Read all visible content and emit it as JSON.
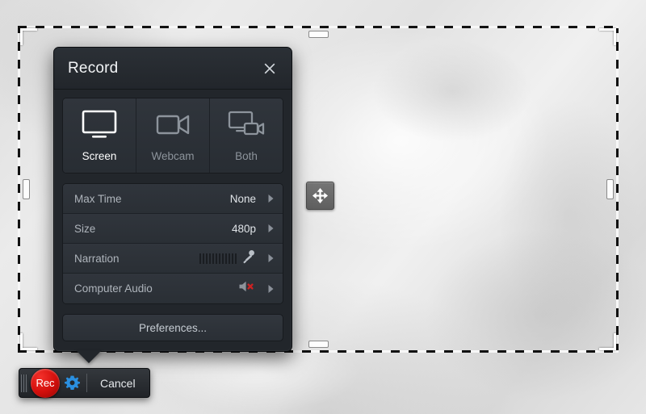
{
  "dialog": {
    "title": "Record",
    "close_icon": "close-icon",
    "modes": [
      {
        "label": "Screen",
        "icon": "monitor-icon",
        "active": true
      },
      {
        "label": "Webcam",
        "icon": "video-camera-icon",
        "active": false
      },
      {
        "label": "Both",
        "icon": "monitor-camera-icon",
        "active": false
      }
    ],
    "rows": [
      {
        "label": "Max Time",
        "value": "None",
        "icon": "",
        "chevron": "chevron-right-icon"
      },
      {
        "label": "Size",
        "value": "480p",
        "icon": "",
        "chevron": "chevron-right-icon"
      },
      {
        "label": "Narration",
        "value": "",
        "icon": "microphone-icon",
        "meter": true,
        "chevron": "chevron-right-icon"
      },
      {
        "label": "Computer Audio",
        "value": "",
        "icon": "speaker-muted-icon",
        "meter": false,
        "chevron": "chevron-right-icon"
      }
    ],
    "preferences_label": "Preferences..."
  },
  "toolbar": {
    "grip_icon": "drag-grip-icon",
    "record_label": "Rec",
    "settings_icon": "gear-icon",
    "cancel_label": "Cancel"
  },
  "selection": {
    "move_icon": "move-arrows-icon",
    "corner_handles": [
      "top-left",
      "top-right",
      "bottom-left",
      "bottom-right"
    ],
    "edge_handles": [
      "top",
      "bottom",
      "left",
      "right"
    ]
  },
  "colors": {
    "dialog_bg": "#22262b",
    "record_red": "#d40f0c",
    "gear_blue": "#2a8fe0",
    "mute_red": "#cc2222",
    "active_text": "#ffffff",
    "inactive_text": "#8d949c"
  },
  "meter": {
    "bars": 12
  }
}
